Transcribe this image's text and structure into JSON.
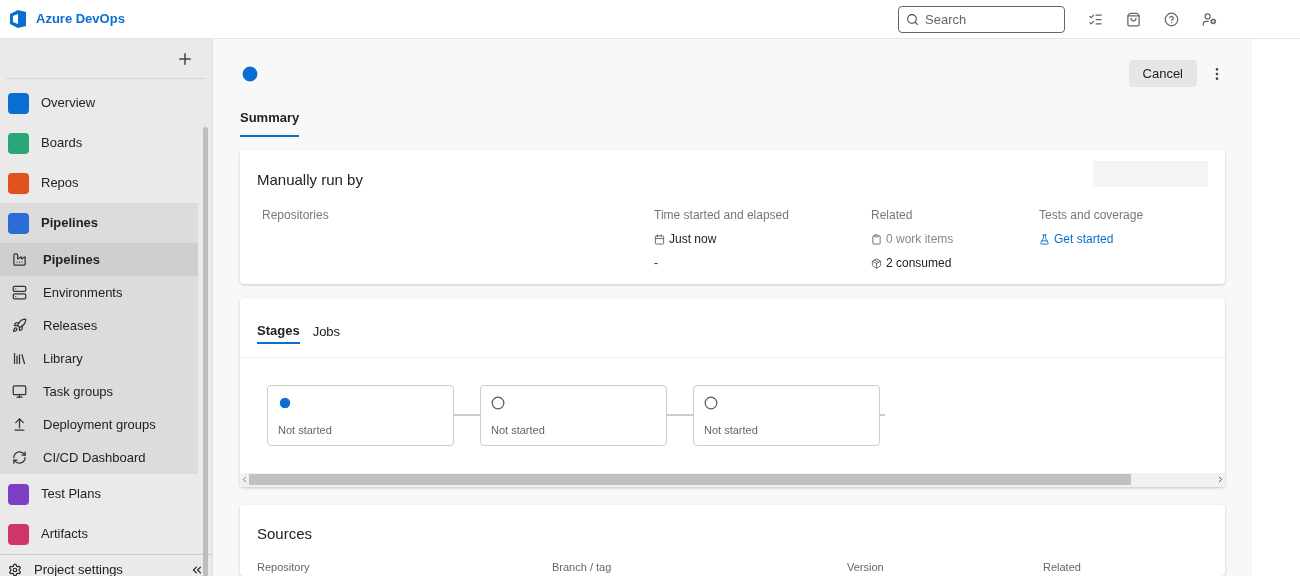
{
  "header": {
    "product": "Azure DevOps",
    "search": {
      "placeholder": "Search"
    }
  },
  "sidebar": {
    "items": [
      {
        "label": "Overview",
        "kind": "overview",
        "selected": false
      },
      {
        "label": "Boards",
        "kind": "boards",
        "selected": false
      },
      {
        "label": "Repos",
        "kind": "repos",
        "selected": false
      },
      {
        "label": "Pipelines",
        "kind": "pipelines",
        "selected": true,
        "children": [
          {
            "label": "Pipelines",
            "kind": "pipelines-sub",
            "selected": true
          },
          {
            "label": "Environments",
            "kind": "environments",
            "selected": false
          },
          {
            "label": "Releases",
            "kind": "releases",
            "selected": false
          },
          {
            "label": "Library",
            "kind": "library",
            "selected": false
          },
          {
            "label": "Task groups",
            "kind": "task-groups",
            "selected": false
          },
          {
            "label": "Deployment groups",
            "kind": "deployment-groups",
            "selected": false
          },
          {
            "label": "CI/CD Dashboard",
            "kind": "dashboard",
            "selected": false
          }
        ]
      },
      {
        "label": "Test Plans",
        "kind": "test-plans",
        "selected": false
      },
      {
        "label": "Artifacts",
        "kind": "artifacts",
        "selected": false
      }
    ],
    "footer": "Project settings"
  },
  "toolbar": {
    "cancel": "Cancel"
  },
  "tabs": [
    {
      "label": "Summary",
      "selected": true
    }
  ],
  "summary": {
    "title": "Manually run by",
    "repositories_label": "Repositories",
    "columns": [
      {
        "heading": "Time started and elapsed",
        "lines": [
          {
            "kind": "date",
            "text": "Just now"
          },
          {
            "kind": "plain",
            "text": "-"
          }
        ]
      },
      {
        "heading": "Related",
        "lines": [
          {
            "kind": "work-items",
            "text": "0 work items"
          },
          {
            "kind": "consumed",
            "text": "2 consumed"
          }
        ]
      },
      {
        "heading": "Tests and coverage",
        "lines": [
          {
            "kind": "tests-link",
            "text": "Get started"
          }
        ]
      }
    ]
  },
  "stages_panel": {
    "tabs": [
      {
        "label": "Stages",
        "selected": true
      },
      {
        "label": "Jobs",
        "selected": false
      }
    ],
    "stages": [
      {
        "kind": "queued",
        "label": "Not started"
      },
      {
        "kind": "pending",
        "label": "Not started"
      },
      {
        "kind": "pending",
        "label": "Not started"
      }
    ]
  },
  "sources": {
    "title": "Sources",
    "columns": [
      "Repository",
      "Branch / tag",
      "Version",
      "Related"
    ]
  }
}
